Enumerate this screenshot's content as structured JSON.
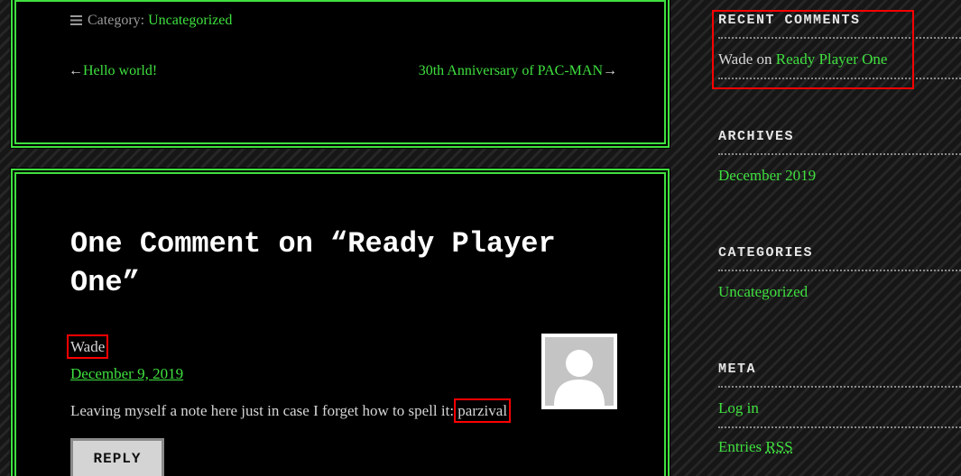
{
  "post_footer": {
    "category_label": "Category:",
    "category_value": "Uncategorized",
    "prev_arrow": "←",
    "prev_link": "Hello world!",
    "next_link": "30th Anniversary of PAC-MAN",
    "next_arrow": "→"
  },
  "comments": {
    "title": "One Comment on “Ready Player One”",
    "items": [
      {
        "author": "Wade",
        "date": "December 9, 2019",
        "text": "Leaving myself a note here just in case I forget how to spell it:",
        "highlight_word": "parzival",
        "reply_label": "REPLY"
      }
    ]
  },
  "sidebar": {
    "recent_comments": {
      "title": "RECENT COMMENTS",
      "author": "Wade",
      "on_word": "on",
      "post_link": "Ready Player One"
    },
    "archives": {
      "title": "ARCHIVES",
      "items": [
        "December 2019"
      ]
    },
    "categories": {
      "title": "CATEGORIES",
      "items": [
        "Uncategorized"
      ]
    },
    "meta": {
      "title": "META",
      "log_in": "Log in",
      "entries_prefix": "Entries",
      "entries_abbr": "RSS"
    }
  },
  "colors": {
    "link_green": "#3fe03f",
    "highlight_red": "#ff0000",
    "card_background": "#000000"
  }
}
